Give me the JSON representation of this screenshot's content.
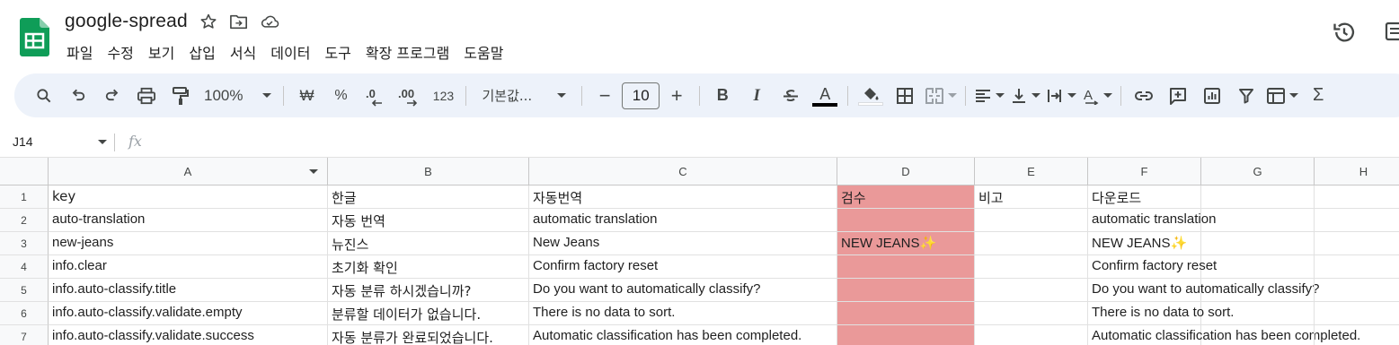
{
  "app": {
    "title": "google-spread",
    "menu": [
      "파일",
      "수정",
      "보기",
      "삽입",
      "서식",
      "데이터",
      "도구",
      "확장 프로그램",
      "도움말"
    ]
  },
  "toolbar": {
    "zoom": "100%",
    "currency": "₩",
    "percent": "%",
    "decrease_decimal": ".0",
    "increase_decimal": ".00",
    "number_format": "123",
    "font_name": "기본값...",
    "minus": "−",
    "font_size": "10",
    "plus": "+",
    "bold": "B",
    "italic": "I",
    "text_color_label": "A",
    "text_color": "#000000",
    "fill_color": "#ffffff"
  },
  "formula_bar": {
    "name_box": "J14",
    "fx": "fx"
  },
  "sheet": {
    "columns": [
      "A",
      "B",
      "C",
      "D",
      "E",
      "F",
      "G",
      "H"
    ],
    "row_numbers": [
      "1",
      "2",
      "3",
      "4",
      "5",
      "6",
      "7"
    ],
    "review_fill": "#ea9999",
    "rows": [
      [
        "key",
        "한글",
        "자동번역",
        "검수",
        "비고",
        "다운로드"
      ],
      [
        "auto-translation",
        "자동 번역",
        "automatic translation",
        "",
        "",
        "automatic translation"
      ],
      [
        "new-jeans",
        "뉴진스",
        "New Jeans",
        "NEW JEANS",
        "",
        "NEW JEANS"
      ],
      [
        "info.clear",
        "초기화 확인",
        "Confirm factory reset",
        "",
        "",
        "Confirm factory reset"
      ],
      [
        "info.auto-classify.title",
        "자동 분류 하시겠습니까?",
        "Do you want to automatically classify?",
        "",
        "",
        "Do you want to automatically classify?"
      ],
      [
        "info.auto-classify.validate.empty",
        "분류할 데이터가 없습니다.",
        "There is no data to sort.",
        "",
        "",
        "There is no data to sort."
      ],
      [
        "info.auto-classify.validate.success",
        "자동 분류가 완료되었습니다.",
        "Automatic classification has been completed.",
        "",
        "",
        "Automatic classification has been completed."
      ]
    ],
    "sparkle": "✨"
  }
}
